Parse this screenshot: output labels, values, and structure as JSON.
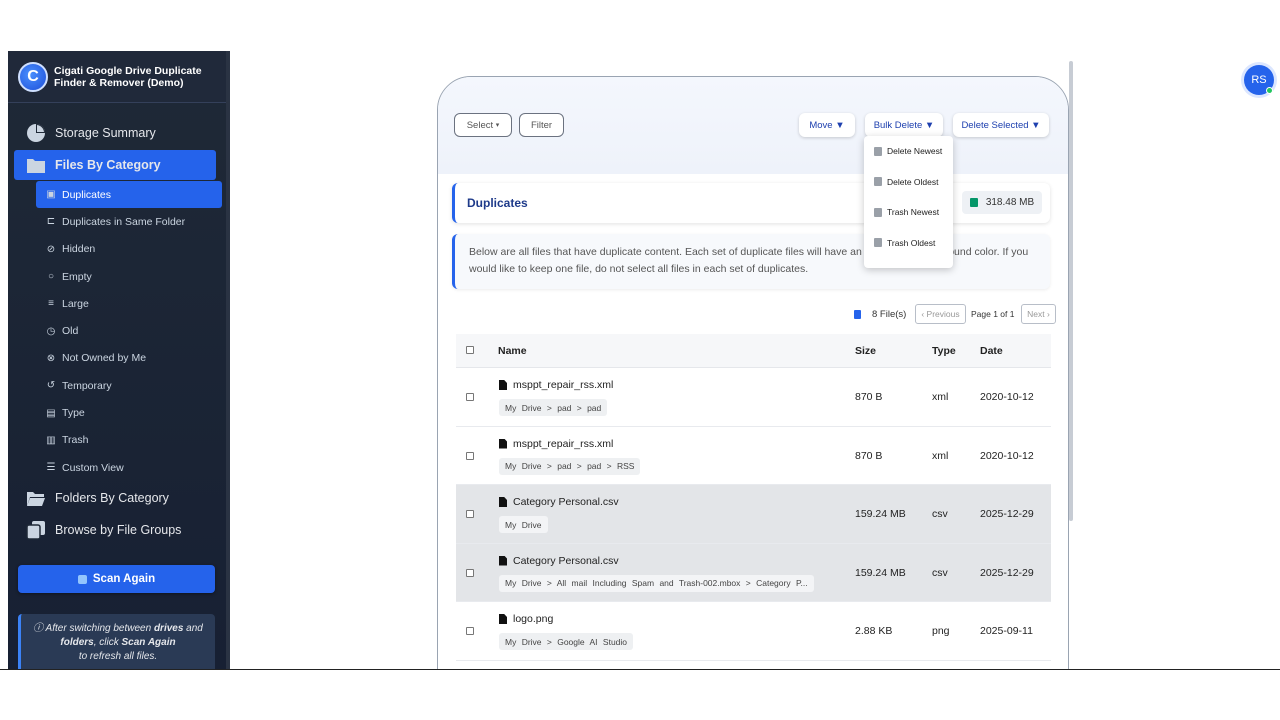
{
  "app": {
    "title": "Cigati Google Drive Duplicate Finder & Remover (Demo)",
    "logo_letter": "C"
  },
  "sidebar": {
    "storage_summary": "Storage Summary",
    "files_by_category": "Files By Category",
    "sub_items": [
      {
        "label": "Duplicates",
        "icon": "duplicates-icon"
      },
      {
        "label": "Duplicates in Same Folder",
        "icon": "folder-tree-icon"
      },
      {
        "label": "Hidden",
        "icon": "eye-slash-icon"
      },
      {
        "label": "Empty",
        "icon": "circle-icon"
      },
      {
        "label": "Large",
        "icon": "database-icon"
      },
      {
        "label": "Old",
        "icon": "clock-icon"
      },
      {
        "label": "Not Owned by Me",
        "icon": "user-slash-icon"
      },
      {
        "label": "Temporary",
        "icon": "history-icon"
      },
      {
        "label": "Type",
        "icon": "file-icon"
      },
      {
        "label": "Trash",
        "icon": "trash-icon"
      },
      {
        "label": "Custom View",
        "icon": "sliders-icon"
      }
    ],
    "folders_by_category": "Folders By Category",
    "browse_by_file_groups": "Browse by File Groups",
    "scan_again": "Scan Again",
    "note_line1_a": "After switching between ",
    "note_line1_b": "drives",
    "note_line1_c": " and",
    "note_line2_a": "folders",
    "note_line2_b": ",  click ",
    "note_line2_c": "Scan Again",
    "note_line3": "to refresh all files."
  },
  "toolbar": {
    "select": "Select",
    "select_caret": "▾",
    "filter": "Filter",
    "move": "Move ▼",
    "bulk_delete": "Bulk Delete ▼",
    "delete_selected": "Delete Selected ▼"
  },
  "bulk_delete_menu": [
    "Delete Newest",
    "Delete Oldest",
    "Trash Newest",
    "Trash Oldest"
  ],
  "section": {
    "title": "Duplicates",
    "total_size": "318.48 MB",
    "info": "Below are all files that have duplicate content. Each set of duplicate files will have an alternating background color. If you would like to keep one file, do not select all files in each set of duplicates."
  },
  "pagination": {
    "file_count": "8 File(s)",
    "previous": "‹ Previous",
    "page_info": "Page 1 of 1",
    "next": "Next ›"
  },
  "table": {
    "columns": [
      "Name",
      "Size",
      "Type",
      "Date"
    ],
    "rows": [
      {
        "name": "msppt_repair_rss.xml",
        "path": "My Drive > pad > pad",
        "size": "870 B",
        "type": "xml",
        "date": "2020-10-12",
        "shaded": false
      },
      {
        "name": "msppt_repair_rss.xml",
        "path": "My Drive > pad > pad > RSS",
        "size": "870 B",
        "type": "xml",
        "date": "2020-10-12",
        "shaded": false
      },
      {
        "name": "Category Personal.csv",
        "path": "My Drive",
        "size": "159.24 MB",
        "type": "csv",
        "date": "2025-12-29",
        "shaded": true
      },
      {
        "name": "Category Personal.csv",
        "path": "My Drive > All mail Including Spam and Trash-002.mbox > Category P...",
        "size": "159.24 MB",
        "type": "csv",
        "date": "2025-12-29",
        "shaded": true
      },
      {
        "name": "logo.png",
        "path": "My Drive > Google AI Studio",
        "size": "2.88 KB",
        "type": "png",
        "date": "2025-09-11",
        "shaded": false
      }
    ]
  },
  "user": {
    "initials": "RS"
  },
  "colors": {
    "accent": "#2563eb",
    "sidebar_bg": "#1f2937",
    "row_shade": "#e3e5e8"
  }
}
